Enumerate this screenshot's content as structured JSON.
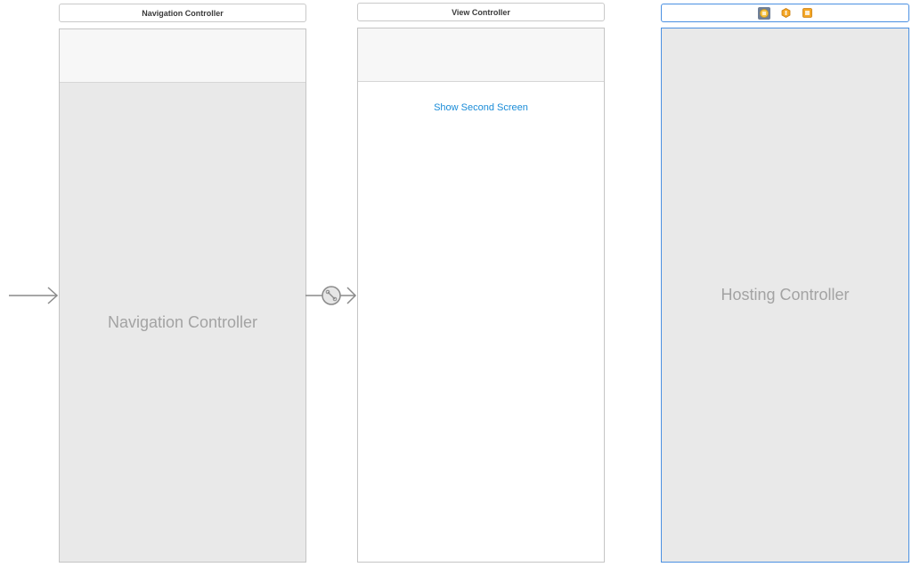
{
  "scenes": {
    "navigation_controller": {
      "title": "Navigation Controller",
      "placeholder": "Navigation Controller"
    },
    "view_controller": {
      "title": "View Controller",
      "button_label": "Show Second Screen"
    },
    "hosting_controller": {
      "placeholder": "Hosting Controller",
      "dock_icons": [
        "view-controller-icon",
        "first-responder-icon",
        "exit-icon"
      ]
    }
  },
  "colors": {
    "selection": "#4a90e2",
    "link": "#1a8cd8",
    "placeholder_text": "#a3a3a3",
    "scene_fill": "#e9e9e9",
    "dock_orange": "#f5a623"
  }
}
